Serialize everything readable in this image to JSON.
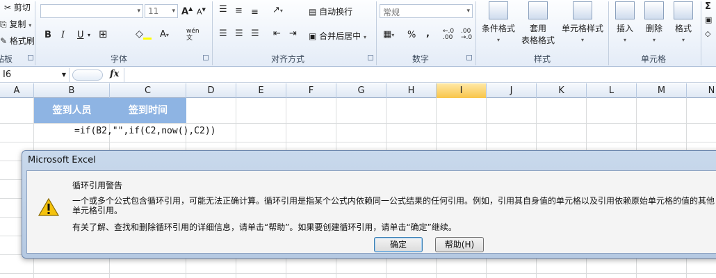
{
  "ribbon": {
    "clipboard": {
      "cut": "剪切",
      "copy": "复制",
      "format_painter": "格式刷",
      "group_partial": "贴板"
    },
    "font": {
      "font_name": "",
      "font_size": "11",
      "grow": "A",
      "shrink": "A",
      "bold": "B",
      "italic": "I",
      "underline": "U",
      "wen": "wén",
      "group": "字体"
    },
    "alignment": {
      "wrap": "自动换行",
      "merge": "合并后居中",
      "group": "对齐方式"
    },
    "number": {
      "format": "常规",
      "percent": "%",
      "comma": ",",
      "group": "数字"
    },
    "styles": {
      "cond_format": "条件格式",
      "table_format_1": "套用",
      "table_format_2": "表格格式",
      "cell_styles": "单元格样式",
      "group": "样式"
    },
    "cells": {
      "insert": "插入",
      "delete": "删除",
      "format": "格式",
      "group": "单元格"
    },
    "editing": {
      "sigma": "Σ"
    }
  },
  "formula_bar": {
    "name_box": "I6",
    "fx": "fx",
    "content": ""
  },
  "columns": [
    "A",
    "B",
    "C",
    "D",
    "E",
    "F",
    "G",
    "H",
    "I",
    "J",
    "K",
    "L",
    "M",
    "N"
  ],
  "selected_column": "I",
  "cells": {
    "b1": "签到人员",
    "c1": "签到时间",
    "b2_formula": "=if(B2,\"\",if(C2,now(),C2))"
  },
  "dialog": {
    "title": "Microsoft Excel",
    "heading": "循环引用警告",
    "body": "一个或多个公式包含循环引用，可能无法正确计算。循环引用是指某个公式内依赖同一公式结果的任何引用。例如，引用其自身值的单元格以及引用依赖原始单元格的值的其他单元格引用。",
    "help_text": "有关了解、查找和删除循环引用的详细信息，请单击“帮助”。如果要创建循环引用，请单击“确定”继续。",
    "ok_label": "确定",
    "help_label": "帮助(H)"
  },
  "colors": {
    "header_fill": "#8eb4e3",
    "selected_column": "#f8c54a"
  }
}
